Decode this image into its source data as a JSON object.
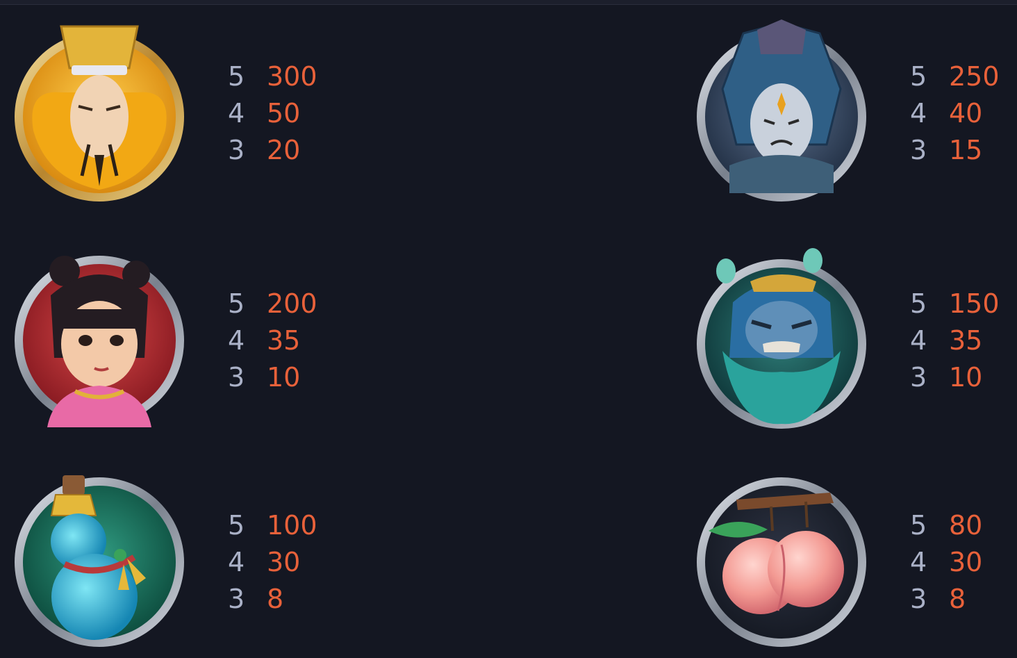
{
  "colors": {
    "background": "#141722",
    "count": "#aab1c7",
    "payout": "#e8613a"
  },
  "symbols": [
    {
      "icon": "emperor-icon",
      "pays": [
        {
          "count": "5",
          "value": "300"
        },
        {
          "count": "4",
          "value": "50"
        },
        {
          "count": "3",
          "value": "20"
        }
      ]
    },
    {
      "icon": "warrior-icon",
      "pays": [
        {
          "count": "5",
          "value": "250"
        },
        {
          "count": "4",
          "value": "40"
        },
        {
          "count": "3",
          "value": "15"
        }
      ]
    },
    {
      "icon": "girl-icon",
      "pays": [
        {
          "count": "5",
          "value": "200"
        },
        {
          "count": "4",
          "value": "35"
        },
        {
          "count": "3",
          "value": "10"
        }
      ]
    },
    {
      "icon": "demon-icon",
      "pays": [
        {
          "count": "5",
          "value": "150"
        },
        {
          "count": "4",
          "value": "35"
        },
        {
          "count": "3",
          "value": "10"
        }
      ]
    },
    {
      "icon": "gourd-icon",
      "pays": [
        {
          "count": "5",
          "value": "100"
        },
        {
          "count": "4",
          "value": "30"
        },
        {
          "count": "3",
          "value": "8"
        }
      ]
    },
    {
      "icon": "peach-icon",
      "pays": [
        {
          "count": "5",
          "value": "80"
        },
        {
          "count": "4",
          "value": "30"
        },
        {
          "count": "3",
          "value": "8"
        }
      ]
    }
  ]
}
